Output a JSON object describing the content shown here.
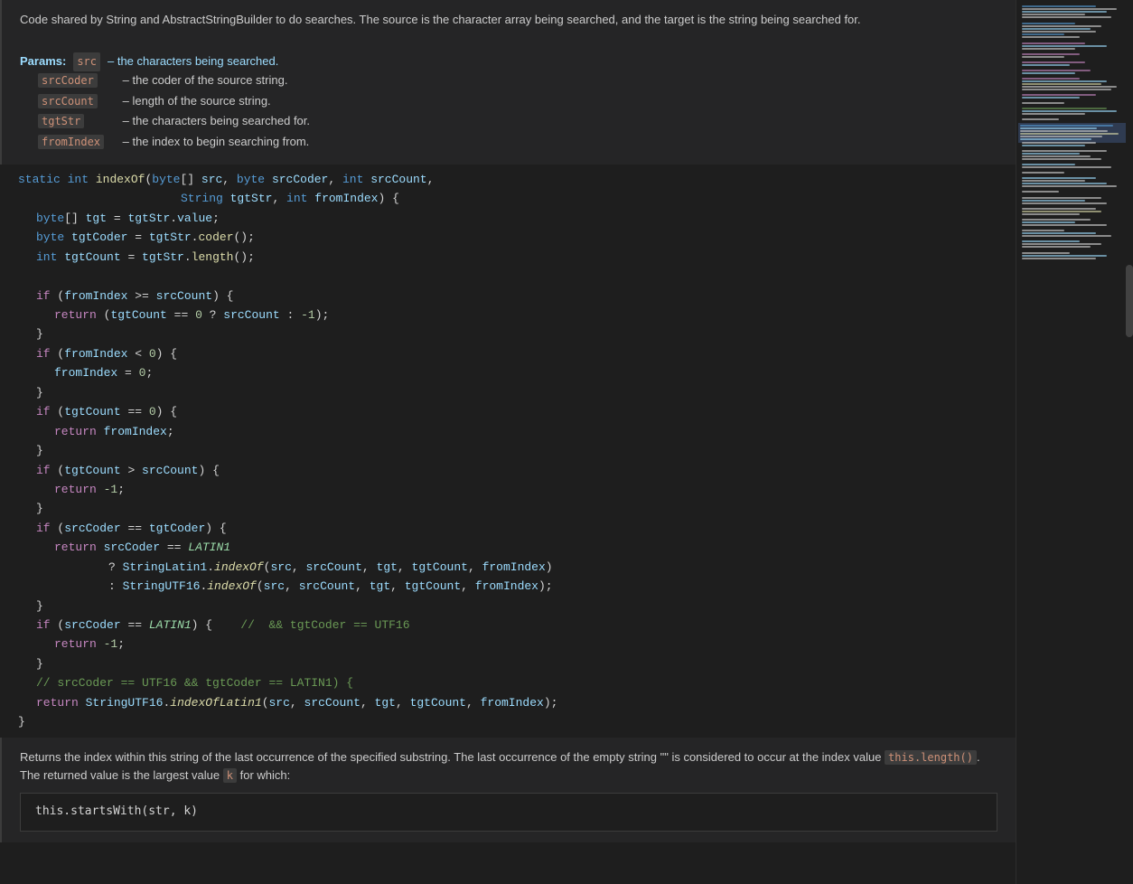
{
  "doc_top": {
    "description": "Code shared by String and AbstractStringBuilder to do searches. The source is the character array being searched, and the target is the string being searched for.",
    "params_label": "Params:",
    "params": [
      {
        "name": "src",
        "desc": "– the characters being searched."
      },
      {
        "name": "srcCoder",
        "desc": "– the coder of the source string."
      },
      {
        "name": "srcCount",
        "desc": "– length of the source string."
      },
      {
        "name": "tgtStr",
        "desc": "– the characters being searched for."
      },
      {
        "name": "fromIndex",
        "desc": "– the index to begin searching from."
      }
    ]
  },
  "code": {
    "line1": "static int indexOf(byte[] src, byte srcCoder, int srcCount,",
    "line2": "                   String tgtStr, int fromIndex) {",
    "line3": "    byte[] tgt = tgtStr.value;",
    "line4": "    byte tgtCoder = tgtStr.coder();",
    "line5": "    int tgtCount = tgtStr.length();",
    "line6": "",
    "line7": "    if (fromIndex >= srcCount) {",
    "line8": "        return (tgtCount == 0 ? srcCount : -1);",
    "line9": "    }",
    "line10": "    if (fromIndex < 0) {",
    "line11": "        fromIndex = 0;",
    "line12": "    }",
    "line13": "    if (tgtCount == 0) {",
    "line14": "        return fromIndex;",
    "line15": "    }",
    "line16": "    if (tgtCount > srcCount) {",
    "line17": "        return -1;",
    "line18": "    }",
    "line19": "    if (srcCoder == tgtCoder) {",
    "line20": "        return srcCoder == LATIN1",
    "line21": "                ? StringLatin1.indexOf(src, srcCount, tgt, tgtCount, fromIndex)",
    "line22": "                : StringUTF16.indexOf(src, srcCount, tgt, tgtCount, fromIndex);",
    "line23": "    }",
    "line24": "    if (srcCoder == LATIN1) {    //  && tgtCoder == UTF16",
    "line25": "        return -1;",
    "line26": "    }",
    "line27": "    // srcCoder == UTF16 && tgtCoder == LATIN1) {",
    "line28": "    return StringUTF16.indexOfLatin1(src, srcCount, tgt, tgtCount, fromIndex);",
    "line29": "}"
  },
  "doc_bottom": {
    "description": "Returns the index within this string of the last occurrence of the specified substring. The last occurrence of the empty string \"\" is considered to occur at the index value",
    "inline_code1": "this.length()",
    "description2": ". The returned value is the largest value",
    "inline_code2": "k",
    "description3": "for which:",
    "example": "this.startsWith(str, k)"
  }
}
